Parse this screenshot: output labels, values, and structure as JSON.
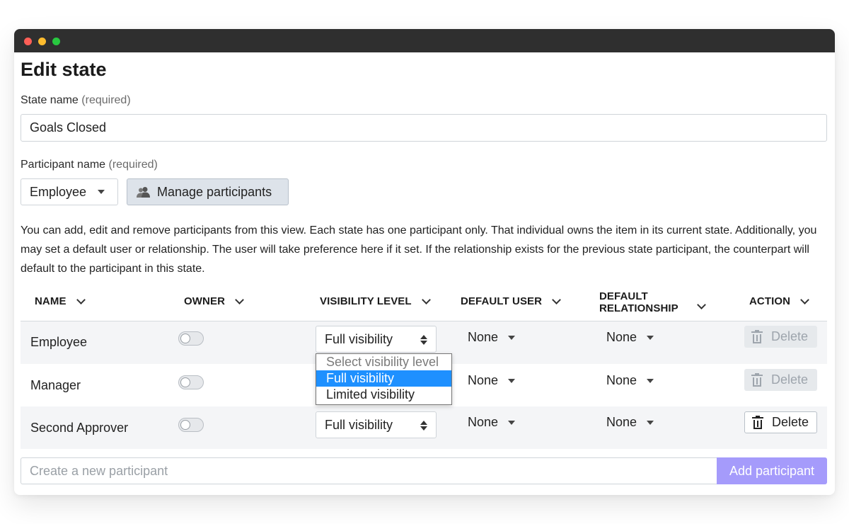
{
  "window": {
    "title_dots": [
      "close",
      "minimize",
      "maximize"
    ]
  },
  "page": {
    "title": "Edit state"
  },
  "state_name": {
    "label": "State name",
    "required": "(required)",
    "value": "Goals Closed"
  },
  "participant": {
    "label": "Participant name",
    "required": "(required)",
    "selected": "Employee",
    "manage_label": "Manage participants"
  },
  "description": "You can add, edit and remove participants from this view. Each state has one participant only. That individual owns the item in its current state. Additionally, you may set a default user or relationship. The user will take preference here if it set. If the relationship exists for the previous state participant, the counterpart will default to the participant in this state.",
  "table": {
    "headers": {
      "name": "NAME",
      "owner": "OWNER",
      "visibility": "VISIBILITY LEVEL",
      "default_user": "DEFAULT USER",
      "default_relationship_1": "DEFAULT",
      "default_relationship_2": "RELATIONSHIP",
      "action": "ACTION"
    },
    "rows": [
      {
        "name": "Employee",
        "owner": false,
        "visibility": "Full visibility",
        "default_user": "None",
        "default_relationship": "None",
        "action": "Delete",
        "action_enabled": false
      },
      {
        "name": "Manager",
        "owner": false,
        "visibility": "Full visibility",
        "default_user": "None",
        "default_relationship": "None",
        "action": "Delete",
        "action_enabled": false
      },
      {
        "name": "Second Approver",
        "owner": false,
        "visibility": "Full visibility",
        "default_user": "None",
        "default_relationship": "None",
        "action": "Delete",
        "action_enabled": true
      }
    ]
  },
  "visibility_dropdown": {
    "options": [
      "Select visibility level",
      "Full visibility",
      "Limited visibility"
    ],
    "selected_index": 1
  },
  "new_participant": {
    "placeholder": "Create a new participant",
    "button": "Add participant"
  },
  "colors": {
    "accent": "#a59bfb",
    "selection": "#1e90ff",
    "titlebar": "#2f2f2f"
  }
}
